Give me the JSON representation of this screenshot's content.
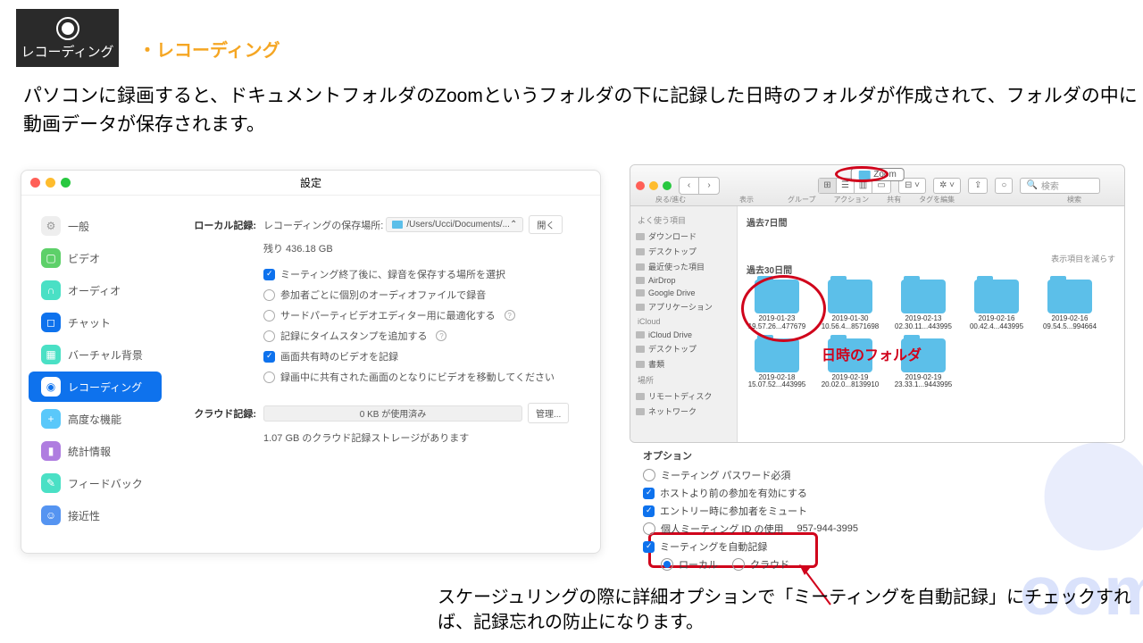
{
  "header": {
    "badge_label": "レコーディング",
    "heading": "・レコーディング"
  },
  "description": "パソコンに録画すると、ドキュメントフォルダのZoomというフォルダの下に記録した日時のフォルダが作成されて、フォルダの中に動画データが保存されます。",
  "settings_window": {
    "title": "設定",
    "sidebar": {
      "items": [
        {
          "label": "一般"
        },
        {
          "label": "ビデオ"
        },
        {
          "label": "オーディオ"
        },
        {
          "label": "チャット"
        },
        {
          "label": "バーチャル背景"
        },
        {
          "label": "レコーディング"
        },
        {
          "label": "高度な機能"
        },
        {
          "label": "統計情報"
        },
        {
          "label": "フィードバック"
        },
        {
          "label": "接近性"
        }
      ]
    },
    "local_record": {
      "label": "ローカル記録:",
      "save_label": "レコーディングの保存場所:",
      "path": "/Users/Ucci/Documents/...",
      "open_btn": "開く",
      "remaining": "残り 436.18 GB",
      "options": [
        {
          "label": "ミーティング終了後に、録音を保存する場所を選択",
          "checked": true
        },
        {
          "label": "参加者ごとに個別のオーディオファイルで録音",
          "checked": false
        },
        {
          "label": "サードパーティビデオエディター用に最適化する",
          "checked": false,
          "info": true
        },
        {
          "label": "記録にタイムスタンプを追加する",
          "checked": false,
          "info": true
        },
        {
          "label": "画面共有時のビデオを記録",
          "checked": true
        },
        {
          "label": "録画中に共有された画面のとなりにビデオを移動してください",
          "checked": false
        }
      ]
    },
    "cloud_record": {
      "label": "クラウド記録:",
      "usage": "0 KB が使用済み",
      "manage_btn": "管理...",
      "storage": "1.07 GB のクラウド記録ストレージがあります"
    }
  },
  "finder": {
    "title": "Zoom",
    "search_placeholder": "検索",
    "back_label": "戻る/進む",
    "toolbar_labels": [
      "表示",
      "グループ",
      "アクション",
      "共有",
      "タグを編集"
    ],
    "search_section_label": "検索",
    "sidebar": {
      "favorites_hdr": "よく使う項目",
      "favorites": [
        "ダウンロード",
        "デスクトップ",
        "最近使った項目",
        "AirDrop",
        "Google Drive",
        "アプリケーション"
      ],
      "icloud_hdr": "iCloud",
      "icloud": [
        "iCloud Drive",
        "デスクトップ",
        "書類"
      ],
      "locations_hdr": "場所",
      "locations": [
        "リモートディスク",
        "ネットワーク"
      ]
    },
    "section7": "過去7日間",
    "section30": "過去30日間",
    "reduce_label": "表示項目を減らす",
    "folders30": [
      {
        "name": "2019-01-23",
        "sub": "19.57.26...477679"
      },
      {
        "name": "2019-01-30",
        "sub": "10.56.4...8571698"
      },
      {
        "name": "2019-02-13",
        "sub": "02.30.11...443995"
      },
      {
        "name": "2019-02-16",
        "sub": "00.42.4...443995"
      },
      {
        "name": "2019-02-16",
        "sub": "09.54.5...994664"
      },
      {
        "name": "2019-02-18",
        "sub": "15.07.52...443995"
      },
      {
        "name": "2019-02-19",
        "sub": "20.02.0...8139910"
      },
      {
        "name": "2019-02-19",
        "sub": "23.33.1...9443995"
      }
    ]
  },
  "annotation": {
    "datetime_folder": "日時のフォルダ"
  },
  "options": {
    "header": "オプション",
    "items": [
      {
        "label": "ミーティング パスワード必須",
        "type": "radio",
        "on": false
      },
      {
        "label": "ホストより前の参加を有効にする",
        "type": "check",
        "on": true
      },
      {
        "label": "エントリー時に参加者をミュート",
        "type": "check",
        "on": true
      },
      {
        "label": "個人ミーティング ID の使用",
        "type": "radio",
        "on": false,
        "extra": "957-944-3995"
      },
      {
        "label": "ミーティングを自動記録",
        "type": "check",
        "on": true
      }
    ],
    "sub": {
      "local": "ローカル",
      "cloud": "クラウド"
    }
  },
  "bottom_text": "スケージュリングの際に詳細オプションで「ミーティングを自動記録」にチェックすれば、記録忘れの防止になります。"
}
